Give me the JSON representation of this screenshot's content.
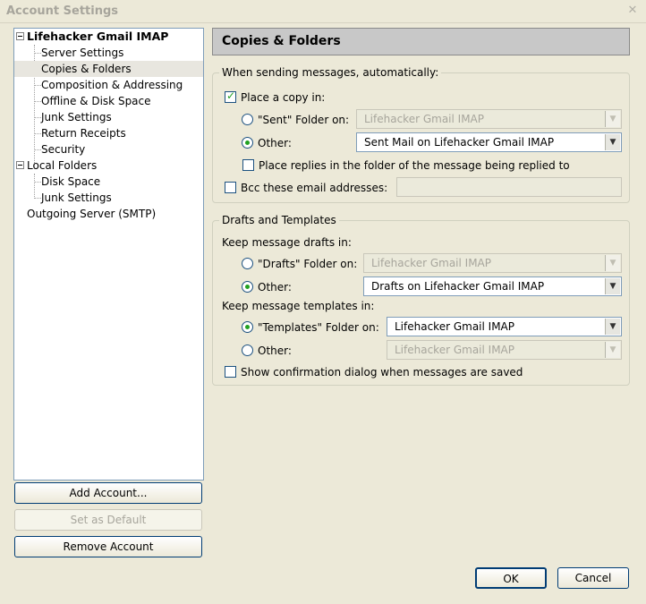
{
  "window": {
    "title": "Account Settings",
    "close_glyph": "✕"
  },
  "sidebar": {
    "account_name": "Lifehacker Gmail IMAP",
    "account_items": [
      "Server Settings",
      "Copies & Folders",
      "Composition & Addressing",
      "Offline & Disk Space",
      "Junk Settings",
      "Return Receipts",
      "Security"
    ],
    "local_folders": "Local Folders",
    "local_items": [
      "Disk Space",
      "Junk Settings"
    ],
    "outgoing": "Outgoing Server (SMTP)",
    "selected": "Copies & Folders"
  },
  "buttons": {
    "add_account": "Add Account...",
    "set_default": "Set as Default",
    "remove_account": "Remove Account",
    "ok": "OK",
    "cancel": "Cancel"
  },
  "panel": {
    "title": "Copies & Folders",
    "sending": {
      "legend": "When sending messages, automatically:",
      "place_copy": "Place a copy in:",
      "place_copy_checked": true,
      "sent_folder_label": "\"Sent\" Folder on:",
      "sent_folder_value": "Lifehacker Gmail IMAP",
      "other_label": "Other:",
      "other_value": "Sent Mail on Lifehacker Gmail IMAP",
      "other_selected": true,
      "place_replies": "Place replies in the folder of the message being replied to",
      "place_replies_checked": false,
      "bcc": "Bcc these email addresses:",
      "bcc_checked": false,
      "bcc_value": ""
    },
    "drafts": {
      "legend": "Drafts and Templates",
      "keep_drafts": "Keep message drafts in:",
      "drafts_folder_label": "\"Drafts\" Folder on:",
      "drafts_folder_value": "Lifehacker Gmail IMAP",
      "drafts_other_label": "Other:",
      "drafts_other_value": "Drafts on Lifehacker Gmail IMAP",
      "drafts_other_selected": true,
      "keep_templates": "Keep message templates in:",
      "templates_folder_label": "\"Templates\" Folder on:",
      "templates_folder_value": "Lifehacker Gmail IMAP",
      "templates_folder_selected": true,
      "templates_other_label": "Other:",
      "templates_other_value": "Lifehacker Gmail IMAP",
      "confirm_dialog": "Show confirmation dialog when messages are saved",
      "confirm_checked": false
    }
  },
  "colors": {
    "accent_check": "#21a121",
    "border_blue": "#003c74",
    "header_bg": "#c8c8c8"
  },
  "icons": {
    "dropdown": "chevron-down-icon",
    "expander": "tree-collapse-icon",
    "close": "close-icon"
  }
}
